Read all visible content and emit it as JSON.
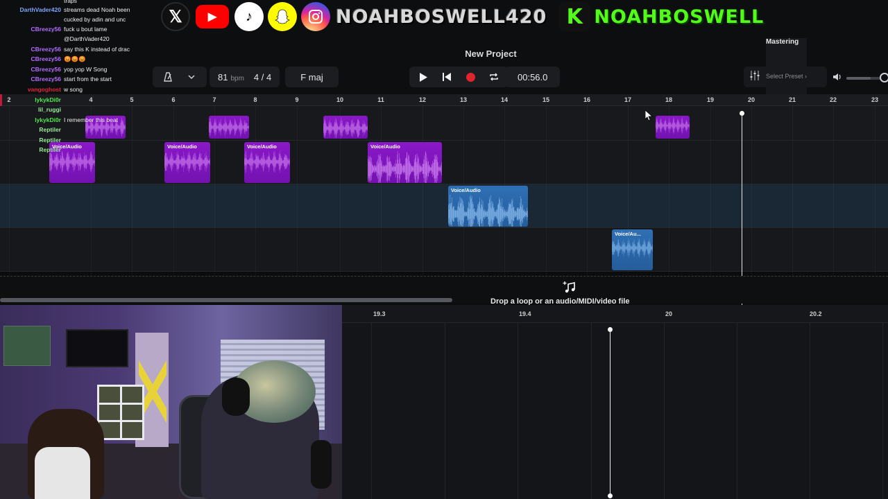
{
  "project": {
    "title": "New Project"
  },
  "toolbar": {
    "bpm_value": "81",
    "bpm_unit": "bpm",
    "time_signature": "4 / 4",
    "key": "F maj",
    "time": "00:56.0",
    "mastering_label": "Mastering",
    "mastering_preset": "Select Preset"
  },
  "overlay": {
    "ig_handle": "NOAHBOSWELL420",
    "kick_letter": "K",
    "kick_handle": "NOAHBOSWELL"
  },
  "chat": [
    {
      "user": "",
      "msg": "traps",
      "color": "#7fa7ff"
    },
    {
      "user": "DarthVader420",
      "msg": "streams dead Noah been",
      "color": "#7fa7ff"
    },
    {
      "user": "",
      "msg": "cucked by adin and unc",
      "color": "#7fa7ff"
    },
    {
      "user": "CBreezy56",
      "msg": "fuck u bout lame",
      "color": "#b26cff"
    },
    {
      "user": "",
      "msg": "@DarthVader420",
      "color": "#b26cff"
    },
    {
      "user": "CBreezy56",
      "msg": "say this K instead of drac",
      "color": "#b26cff"
    },
    {
      "user": "CBreezy56",
      "msg": "😡😡😡",
      "color": "#b26cff"
    },
    {
      "user": "CBreezy56",
      "msg": "yop yop W Song",
      "color": "#b26cff"
    },
    {
      "user": "CBreezy56",
      "msg": "start from the start",
      "color": "#b26cff"
    },
    {
      "user": "vangoghost",
      "msg": "w song",
      "color": "#e0243b"
    },
    {
      "user": "lykykDi0r",
      "msg": "",
      "color": "#4fe84f"
    },
    {
      "user": "lil_ruggi",
      "msg": "",
      "color": "#9ae89a"
    },
    {
      "user": "lykykDi0r",
      "msg": "I remember this beat",
      "color": "#4fe84f"
    },
    {
      "user": "Reptiler",
      "msg": "",
      "color": "#9ae89a"
    },
    {
      "user": "Reptiler",
      "msg": "",
      "color": "#9ae89a"
    },
    {
      "user": "Reptiler",
      "msg": "",
      "color": "#9ae89a"
    }
  ],
  "ruler": [
    "2",
    "4",
    "5",
    "6",
    "7",
    "8",
    "9",
    "10",
    "11",
    "12",
    "13",
    "14",
    "15",
    "16",
    "17",
    "18",
    "19",
    "20",
    "21",
    "22",
    "23"
  ],
  "clips": {
    "label": "Voice/Audio",
    "label_short": "Voice/Au..."
  },
  "drop_zone": {
    "text": "Drop a loop or an audio/MIDI/video file"
  },
  "editor_ruler": [
    "19.3",
    "19.4",
    "20",
    "20.2"
  ],
  "colors": {
    "clip_purple": "#8a18c8",
    "clip_blue": "#2f6fb4",
    "record": "#e0242b",
    "kick": "#53fc18"
  }
}
